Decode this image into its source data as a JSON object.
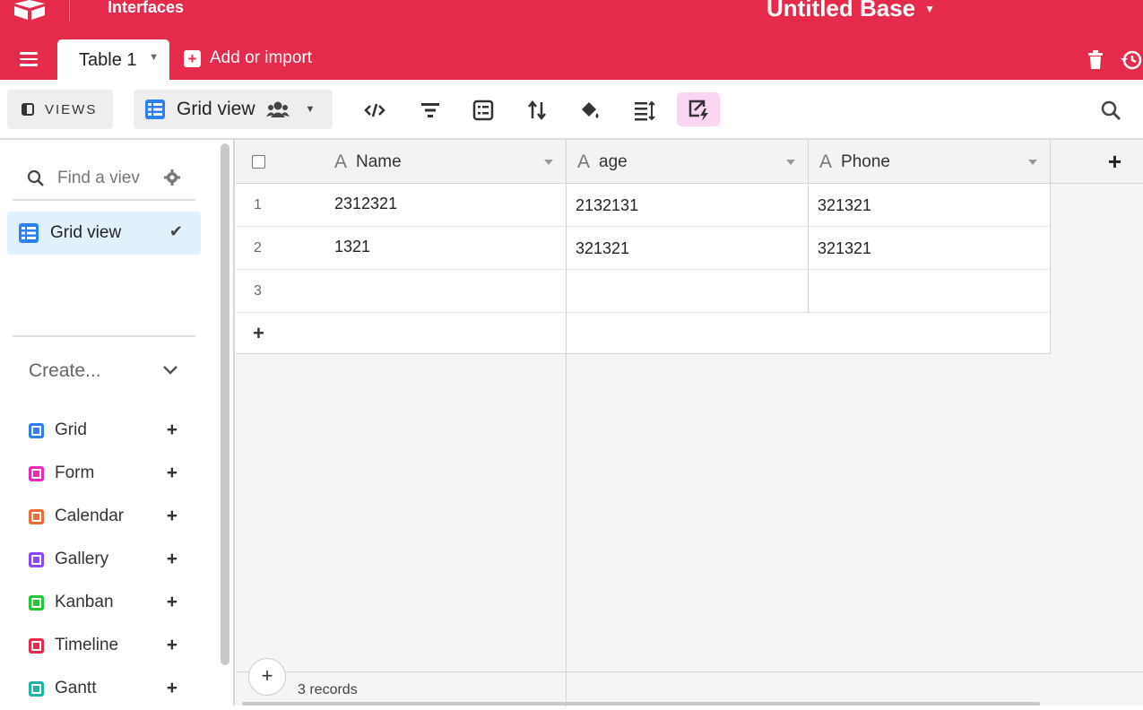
{
  "app": {
    "nav_title": "Interfaces",
    "base_title": "Untitled Base",
    "brand_color": "#e42b4b"
  },
  "tabs": {
    "active": "Table 1",
    "add_import": "Add or import"
  },
  "toolbar": {
    "views_label": "VIEWS",
    "current_view": "Grid view"
  },
  "sidebar": {
    "search_placeholder": "Find a view",
    "search_visible": "Find a viev",
    "selected_view": "Grid view",
    "create_label": "Create...",
    "create_items": [
      {
        "label": "Grid",
        "color": "#2d7ff9"
      },
      {
        "label": "Form",
        "color": "#e929ba"
      },
      {
        "label": "Calendar",
        "color": "#f06a35"
      },
      {
        "label": "Gallery",
        "color": "#8b46ff"
      },
      {
        "label": "Kanban",
        "color": "#20c933"
      },
      {
        "label": "Timeline",
        "color": "#e42b4b"
      },
      {
        "label": "Gantt",
        "color": "#20b4a8"
      }
    ]
  },
  "grid": {
    "columns": [
      "Name",
      "age",
      "Phone"
    ],
    "rows": [
      {
        "num": "1",
        "name": "2312321",
        "age": "2132131",
        "phone": "321321"
      },
      {
        "num": "2",
        "name": "1321",
        "age": "321321",
        "phone": "321321"
      },
      {
        "num": "3",
        "name": "",
        "age": "",
        "phone": ""
      }
    ],
    "records": "3 records"
  }
}
